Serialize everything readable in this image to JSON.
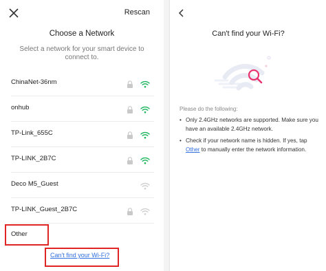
{
  "left": {
    "rescan_label": "Rescan",
    "title": "Choose a Network",
    "subtitle": "Select a network for your smart device to connect to.",
    "networks": [
      {
        "name": "ChinaNet-36nm",
        "locked": true,
        "signal": "strong"
      },
      {
        "name": "onhub",
        "locked": true,
        "signal": "strong"
      },
      {
        "name": "TP-Link_655C",
        "locked": true,
        "signal": "strong"
      },
      {
        "name": "TP-LINK_2B7C",
        "locked": true,
        "signal": "strong"
      },
      {
        "name": "Deco M5_Guest",
        "locked": false,
        "signal": "weak"
      },
      {
        "name": "TP-LINK_Guest_2B7C",
        "locked": true,
        "signal": "weak"
      }
    ],
    "other_label": "Other",
    "help_link": "Can't find your Wi-Fi?"
  },
  "right": {
    "title": "Can't find your Wi-Fi?",
    "instructions_heading": "Please do the following:",
    "bullet1": "Only 2.4GHz networks are supported. Make sure you have an available 2.4GHz network.",
    "bullet2_before": "Check if your network name is hidden. If yes, tap ",
    "bullet2_link": "Other",
    "bullet2_after": " to manually enter the network information.",
    "bullet_glyph": "•"
  },
  "colors": {
    "accent_green": "#1bb55c",
    "weak_signal": "#cfcfcf",
    "lock_gray": "#c9c9c9",
    "highlight_red": "#e02424",
    "link_blue": "#2f6fe0",
    "search_pink": "#e8336f"
  },
  "icons": {
    "close": "close-icon",
    "back": "chevron-left-icon",
    "lock": "lock-icon",
    "wifi": "wifi-icon",
    "search": "search-icon"
  }
}
